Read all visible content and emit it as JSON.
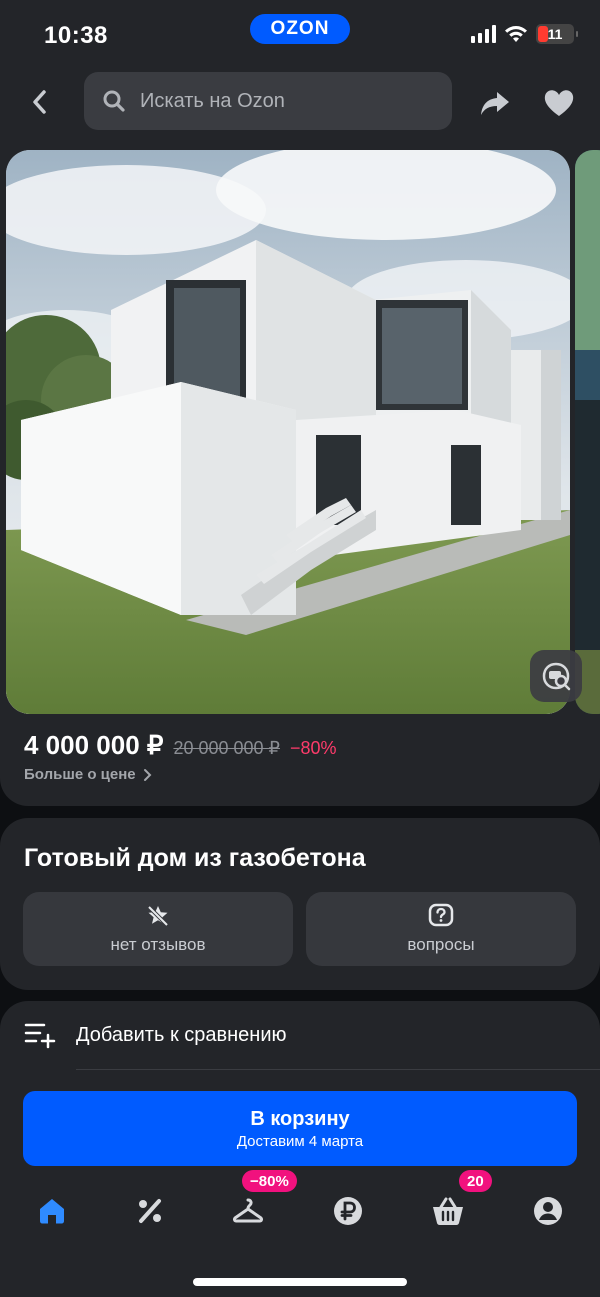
{
  "status_bar": {
    "time": "10:38",
    "battery": "11"
  },
  "brand": {
    "logo": "OZON",
    "color": "#005bff"
  },
  "header": {
    "search_placeholder": "Искать на Ozon",
    "back_icon": "chevron-left-icon",
    "share_icon": "share-icon",
    "favorite_icon": "heart-icon"
  },
  "product": {
    "image_alt": "Белый двухэтажный дом из газобетона",
    "price": "4 000 000 ₽",
    "old_price": "20 000 000 ₽",
    "discount": "−80%",
    "price_more": "Больше о цене",
    "title": "Готовый дом из газобетона",
    "reviews_label": "нет отзывов",
    "questions_label": "вопросы"
  },
  "actions": {
    "compare_label": "Добавить к сравнению",
    "cart_title": "В корзину",
    "cart_subtitle": "Доставим 4 марта"
  },
  "tabs": [
    {
      "name": "home",
      "icon": "home-icon",
      "active": true
    },
    {
      "name": "discounts",
      "icon": "percent-icon"
    },
    {
      "name": "fresh",
      "icon": "hanger-icon",
      "badge": "−80%"
    },
    {
      "name": "finance",
      "icon": "ruble-icon"
    },
    {
      "name": "cart",
      "icon": "basket-icon",
      "badge": "20"
    },
    {
      "name": "profile",
      "icon": "profile-icon"
    }
  ],
  "colors": {
    "accent": "#005bff",
    "discount": "#ff3b6b",
    "badge": "#f1117e",
    "card": "#232529"
  }
}
